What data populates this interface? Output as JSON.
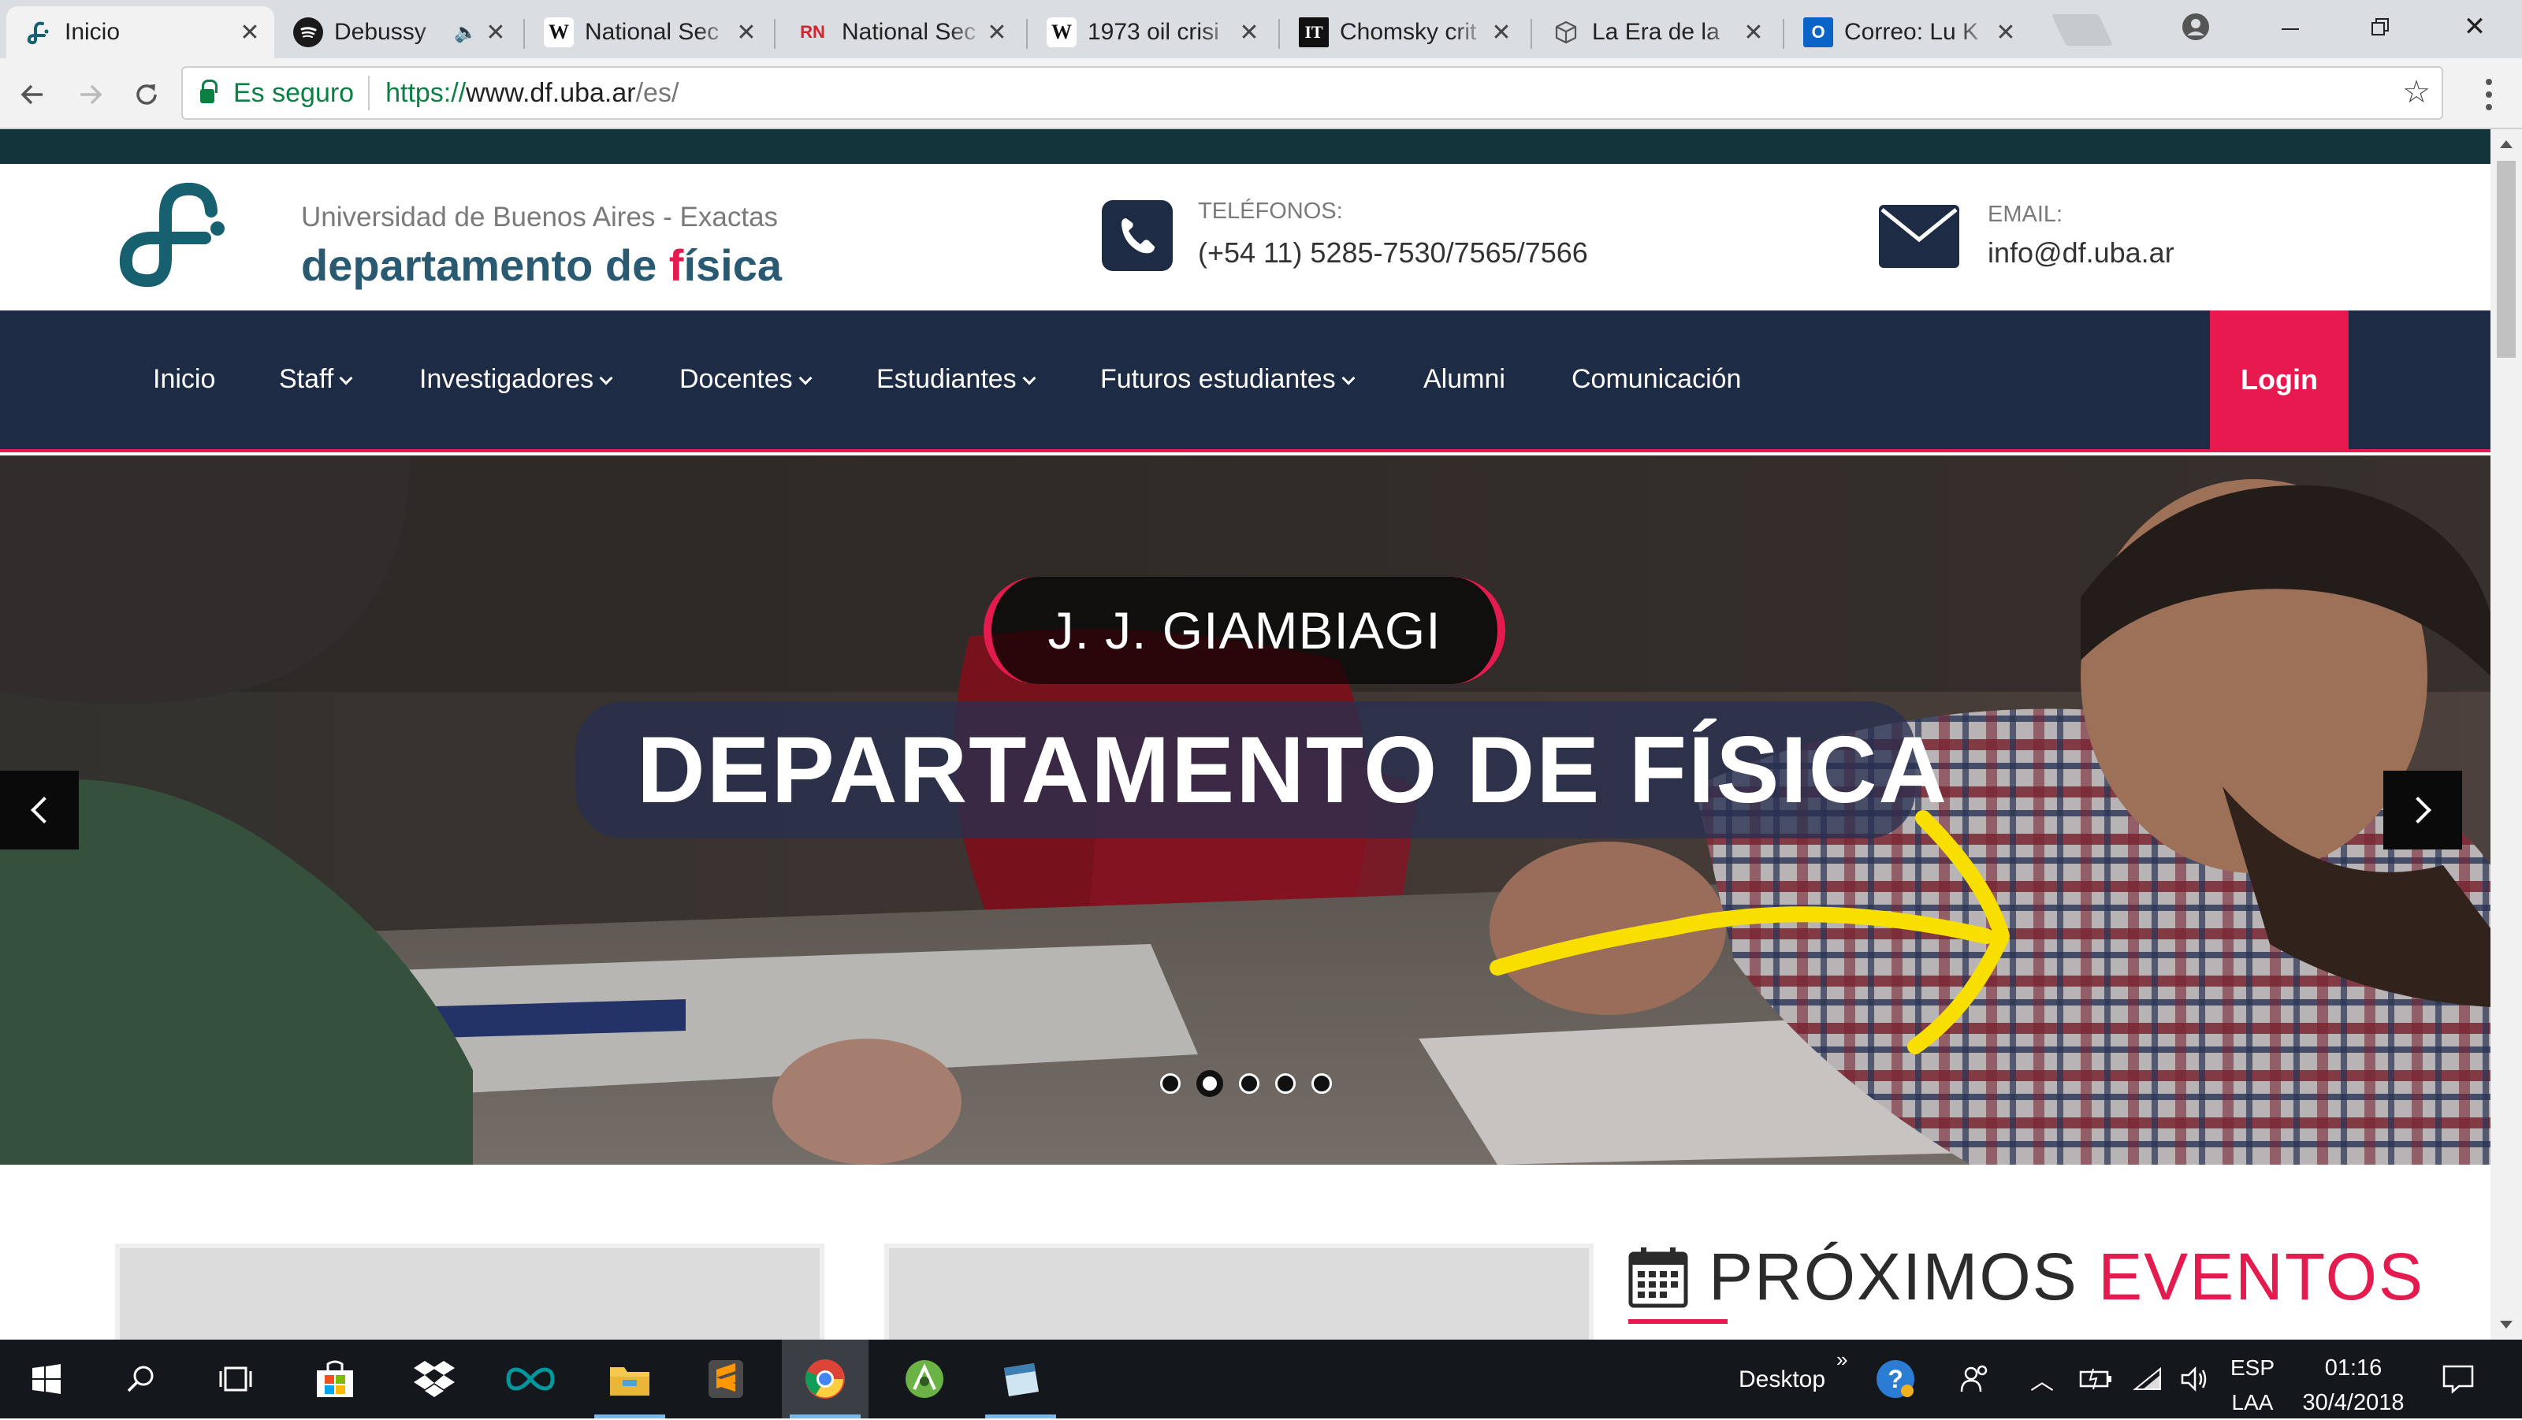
{
  "browser": {
    "tabs": [
      {
        "title": "Inicio",
        "active": true,
        "favicon": "df-logo-icon"
      },
      {
        "title": "Debussy",
        "active": false,
        "favicon": "spotify-icon",
        "audio": true
      },
      {
        "title": "National Sec",
        "active": false,
        "favicon": "wikipedia-icon"
      },
      {
        "title": "National Sec",
        "active": false,
        "favicon": "rn-icon"
      },
      {
        "title": "1973 oil crisi",
        "active": false,
        "favicon": "wikipedia-icon"
      },
      {
        "title": "Chomsky crit",
        "active": false,
        "favicon": "it-icon"
      },
      {
        "title": "La Era de la",
        "active": false,
        "favicon": "cube-icon"
      },
      {
        "title": "Correo: Lu K",
        "active": false,
        "favicon": "outlook-icon"
      }
    ],
    "favicon_text": {
      "wikipedia": "W",
      "rn": "RN",
      "it": "IT",
      "outlook": "O"
    },
    "security_label": "Es seguro",
    "url": {
      "scheme": "https://",
      "host": "www.df.uba.ar",
      "path": "/es/"
    }
  },
  "site": {
    "university": "Universidad de Buenos Aires - Exactas",
    "dept_name_d": "d",
    "dept_name_mid": "epartamento de ",
    "dept_name_f": "f",
    "dept_name_rest": "ísica",
    "phone_label": "TELÉFONOS:",
    "phone_value": "(+54 11) 5285-7530/7565/7566",
    "email_label": "EMAIL:",
    "email_value": "info@df.uba.ar",
    "colors": {
      "navy": "#1d2b45",
      "accent": "#e31b4f",
      "teal": "#16606f"
    }
  },
  "nav": {
    "items": [
      {
        "label": "Inicio",
        "dropdown": false
      },
      {
        "label": "Staff",
        "dropdown": true
      },
      {
        "label": "Investigadores",
        "dropdown": true
      },
      {
        "label": "Docentes",
        "dropdown": true
      },
      {
        "label": "Estudiantes",
        "dropdown": true
      },
      {
        "label": "Futuros estudiantes",
        "dropdown": true
      },
      {
        "label": "Alumni",
        "dropdown": false
      },
      {
        "label": "Comunicación",
        "dropdown": false
      }
    ],
    "login": "Login"
  },
  "hero": {
    "kicker": "J. J. GIAMBIAGI",
    "headline": "DEPARTAMENTO DE FÍSICA",
    "slide_count": 5,
    "active_slide": 2
  },
  "content": {
    "events_title_1": "PRÓXIMOS ",
    "events_title_2": "EVENTOS"
  },
  "taskbar": {
    "desktop_label": "Desktop",
    "language_top": "ESP",
    "language_bottom": "LAA",
    "time": "01:16",
    "date": "30/4/2018"
  }
}
